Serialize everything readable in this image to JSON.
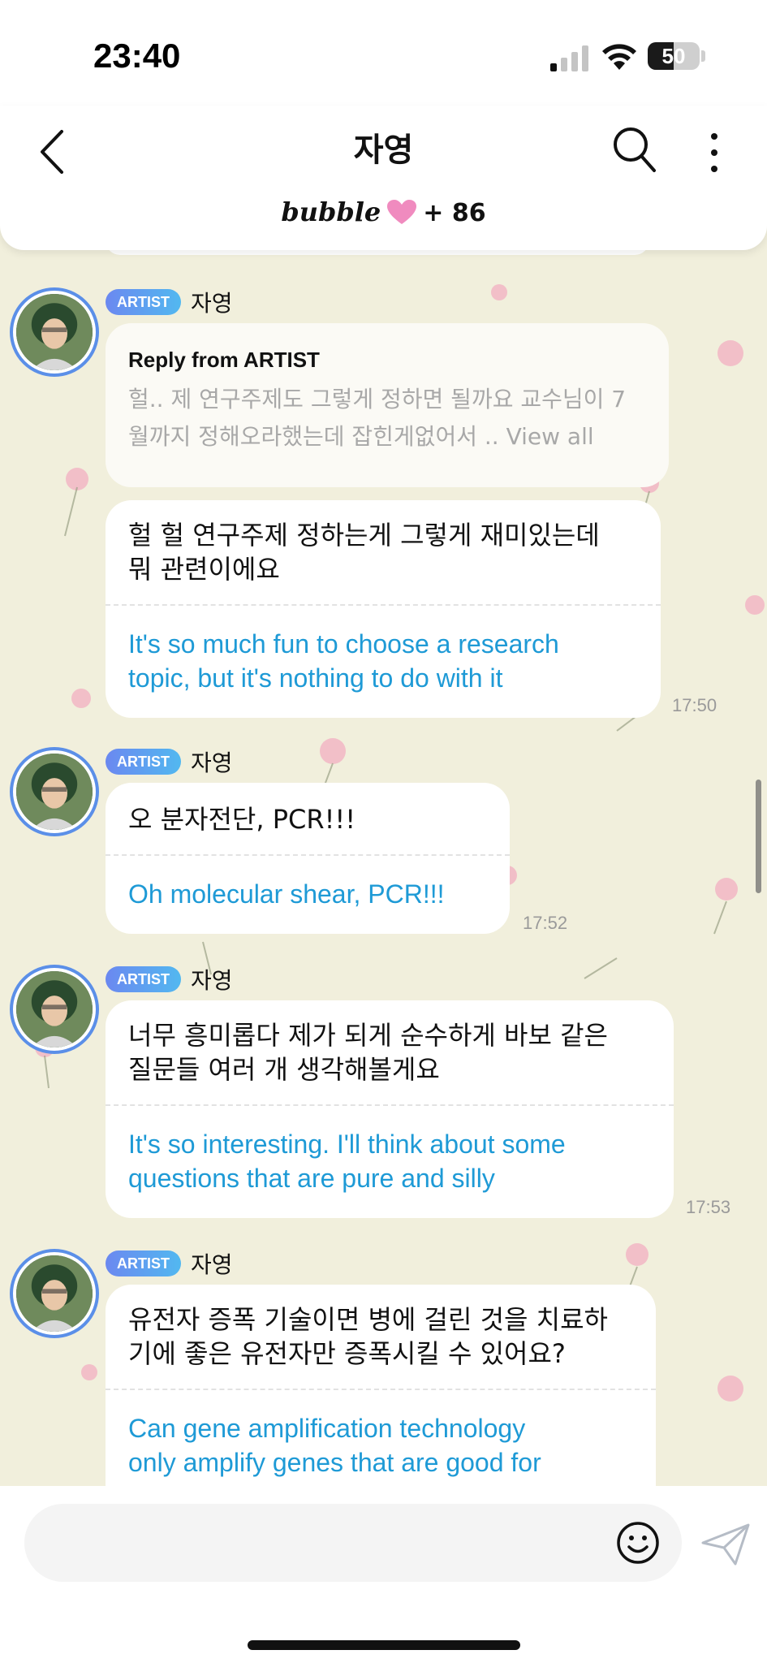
{
  "status_bar": {
    "time": "23:40",
    "battery_level": "50"
  },
  "header": {
    "title": "자영",
    "bubble_logo": "bubble",
    "bubble_count": "+ 86",
    "heart_color": "#f08bbf"
  },
  "colors": {
    "artist_badge": "#6b88f0",
    "translation_text": "#1e9ad6",
    "avatar_ring": "#5b8fe8"
  },
  "messages": [
    {
      "sender_badge": "ARTIST",
      "sender_name": "자영",
      "reply": {
        "title": "Reply from ARTIST",
        "body_line1": "헐.. 제 연구주제도 그렇게 정하면 될까요 교수님이 7",
        "body_line2": "월까지 정해오라했는데 잡힌게없어서 .. View all"
      },
      "ko_line1": "헐 헐 연구주제 정하는게 그렇게 재미있는데",
      "ko_line2": "뭐 관련이에요",
      "en_line1": "It's so much fun to choose a research",
      "en_line2": "topic, but it's nothing to do with it",
      "time": "17:50"
    },
    {
      "sender_badge": "ARTIST",
      "sender_name": "자영",
      "ko_line1": "오 분자전단, PCR!!!",
      "en_line1": "Oh molecular shear, PCR!!!",
      "time": "17:52"
    },
    {
      "sender_badge": "ARTIST",
      "sender_name": "자영",
      "ko_line1": "너무 흥미롭다 제가 되게 순수하게 바보 같은",
      "ko_line2": "질문들 여러 개 생각해볼게요",
      "en_line1": "It's so interesting. I'll think about some",
      "en_line2": "questions that are pure and silly",
      "time": "17:53"
    },
    {
      "sender_badge": "ARTIST",
      "sender_name": "자영",
      "ko_line1": "유전자 증폭 기술이면 병에 걸린 것을 치료하",
      "ko_line2": "기에 좋은 유전자만 증폭시킬 수 있어요?",
      "en_line1": "Can gene amplification technology",
      "en_line2": "only amplify genes that are good for"
    }
  ],
  "input": {
    "placeholder": ""
  },
  "icons": {
    "back": "chevron-left-icon",
    "search": "search-icon",
    "more": "more-vertical-icon",
    "emoji": "emoji-icon",
    "send": "send-icon"
  }
}
